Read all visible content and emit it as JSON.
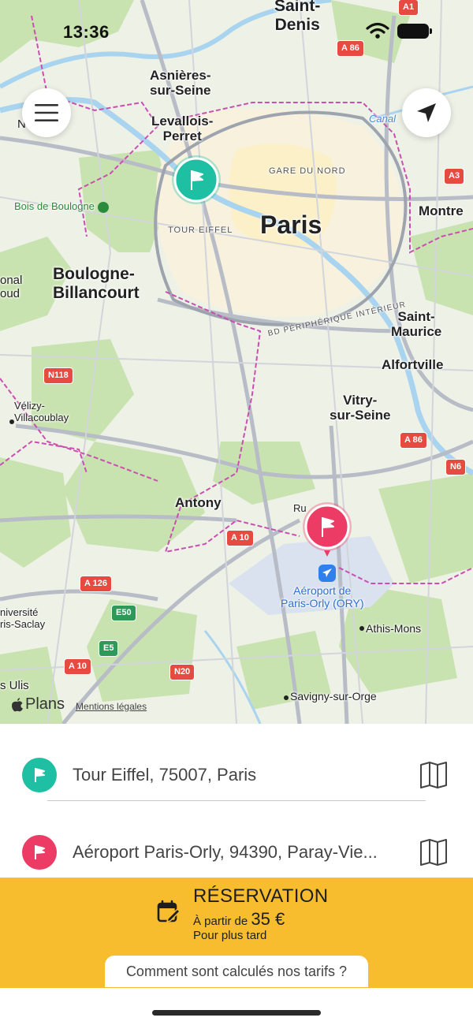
{
  "status": {
    "time": "13:36"
  },
  "map": {
    "labels": {
      "saint_denis": "Saint-\nDenis",
      "asnieres": "Asnières-\nsur-Seine",
      "levallois": "Levallois-\nPerret",
      "nanterre_partial": "Nanterre",
      "bois_boulogne": "Bois de Boulogne",
      "gare_nord": "GARE DU NORD",
      "canal": "Canal",
      "montreuil_partial": "Montre",
      "tour_eiffel": "TOUR EIFFEL",
      "paris": "Paris",
      "boulogne": "Boulogne-\nBillancourt",
      "national_partial": "onal\noud",
      "peripherique": "BD PÉRIPHÉRIQUE INTÉRIEUR",
      "saint_maurice": "Saint-\nMaurice",
      "alfortville": "Alfortville",
      "velizy": "Vélizy-\nVillacoublay",
      "vitry": "Vitry-\nsur-Seine",
      "antony": "Antony",
      "rungis_partial": "Ru",
      "aeroport": "Aéroport de\nParis-Orly (ORY)",
      "universite": "niversité\nris-Saclay",
      "athis_mons": "Athis-Mons",
      "les_ulis": "s Ulis",
      "savigny": "Savigny-sur-Orge"
    },
    "shields": {
      "a1": "A1",
      "a86_top": "A 86",
      "a3": "A3",
      "n118": "N118",
      "a86_mid": "A 86",
      "n6": "N6",
      "a10_mid": "A 10",
      "a126": "A 126",
      "e50": "E50",
      "e5": "E5",
      "a10_low": "A 10",
      "n20": "N20"
    },
    "attribution": {
      "brand": "Plans",
      "legal": "Mentions légales"
    },
    "pins": [
      {
        "name": "origin-pin",
        "color": "#1fbfa4",
        "icon": "flag-icon"
      },
      {
        "name": "destination-pin",
        "color": "#ec3b64",
        "icon": "flag-icon"
      }
    ]
  },
  "addresses": {
    "origin": {
      "text": "Tour Eiffel, 75007, Paris",
      "color": "#1fbfa4",
      "icon": "flag-icon",
      "action_icon": "book-icon"
    },
    "destination": {
      "text": "Aéroport Paris-Orly, 94390, Paray-Vie...",
      "color": "#ec3b64",
      "icon": "flag-icon",
      "action_icon": "book-icon"
    }
  },
  "reservation": {
    "title": "RÉSERVATION",
    "price_prefix": "À partir de ",
    "price_amount": "35 €",
    "subtitle": "Pour plus tard",
    "icon": "calendar-edit-icon",
    "background": "#f8bd2f"
  },
  "tarifs_link": "Comment sont calculés nos tarifs ?"
}
